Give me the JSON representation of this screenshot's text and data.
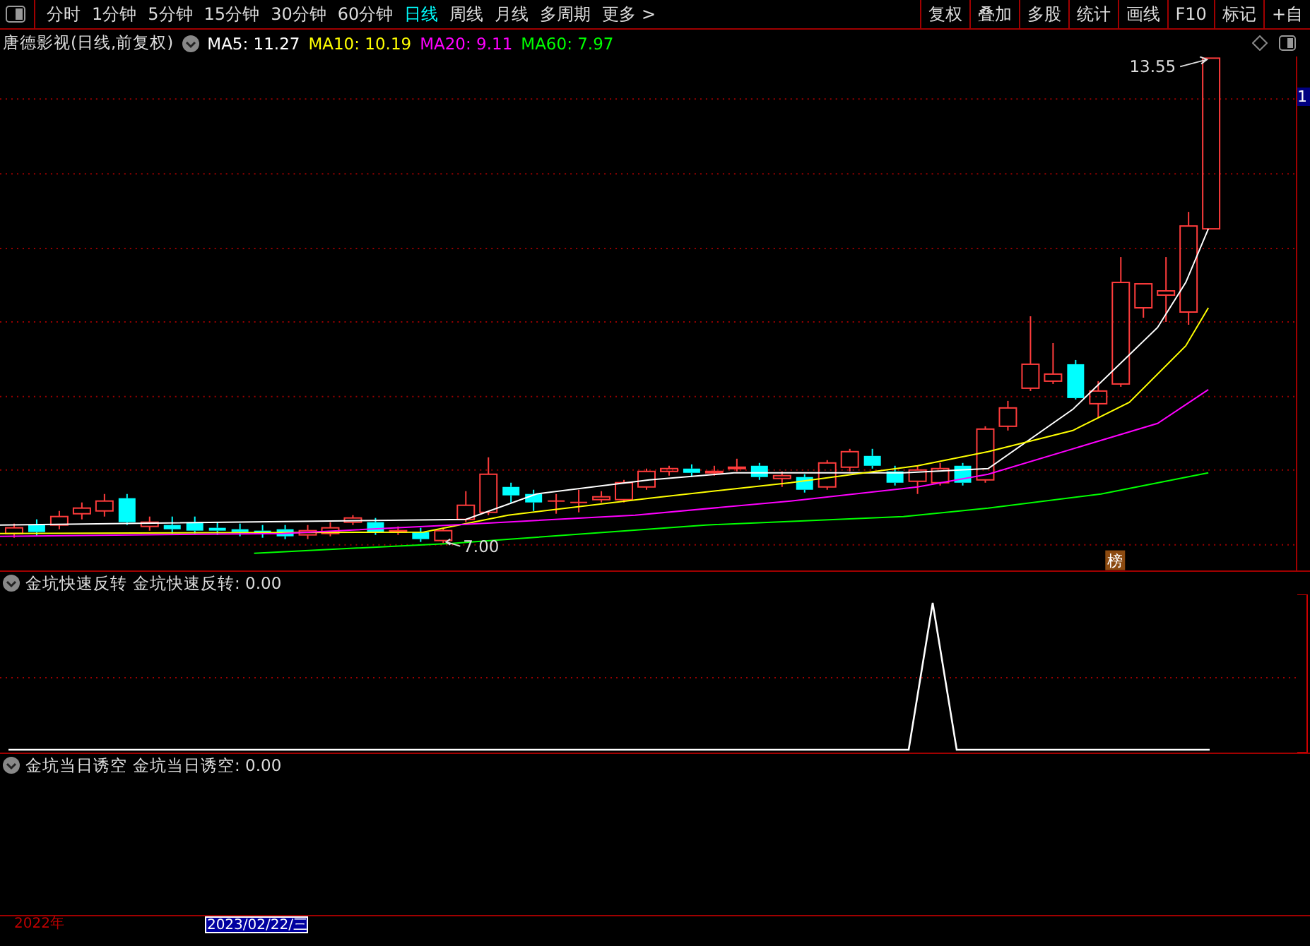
{
  "toolbar": {
    "periods": [
      {
        "label": "分时",
        "selected": false
      },
      {
        "label": "1分钟",
        "selected": false
      },
      {
        "label": "5分钟",
        "selected": false
      },
      {
        "label": "15分钟",
        "selected": false
      },
      {
        "label": "30分钟",
        "selected": false
      },
      {
        "label": "60分钟",
        "selected": false
      },
      {
        "label": "日线",
        "selected": true
      },
      {
        "label": "周线",
        "selected": false
      },
      {
        "label": "月线",
        "selected": false
      },
      {
        "label": "多周期",
        "selected": false
      },
      {
        "label": "更多 >",
        "selected": false
      }
    ],
    "tools": [
      "复权",
      "叠加",
      "多股",
      "统计",
      "画线",
      "F10",
      "标记",
      "+自"
    ]
  },
  "chart": {
    "stock_label": "唐德影视(日线,前复权)",
    "ma": [
      {
        "label": "MA5: 11.27",
        "color": "#ffffff"
      },
      {
        "label": "MA10: 10.19",
        "color": "#ffff00"
      },
      {
        "label": "MA20: 9.11",
        "color": "#ff00ff"
      },
      {
        "label": "MA60: 7.97",
        "color": "#00ff00"
      }
    ],
    "high_label": "13.55",
    "low_label": "7.00",
    "badge": "榜",
    "axis_marker": "1"
  },
  "indicators": [
    {
      "kind": "spike",
      "name": "金坑快速反转",
      "reading": "金坑快速反转: 0.00"
    },
    {
      "kind": "empty",
      "name": "金坑当日诱空",
      "reading": "金坑当日诱空: 0.00"
    }
  ],
  "time_axis": [
    {
      "label": "2022年",
      "selected": false
    },
    {
      "label": "2023/02/22/三",
      "selected": true
    }
  ]
}
